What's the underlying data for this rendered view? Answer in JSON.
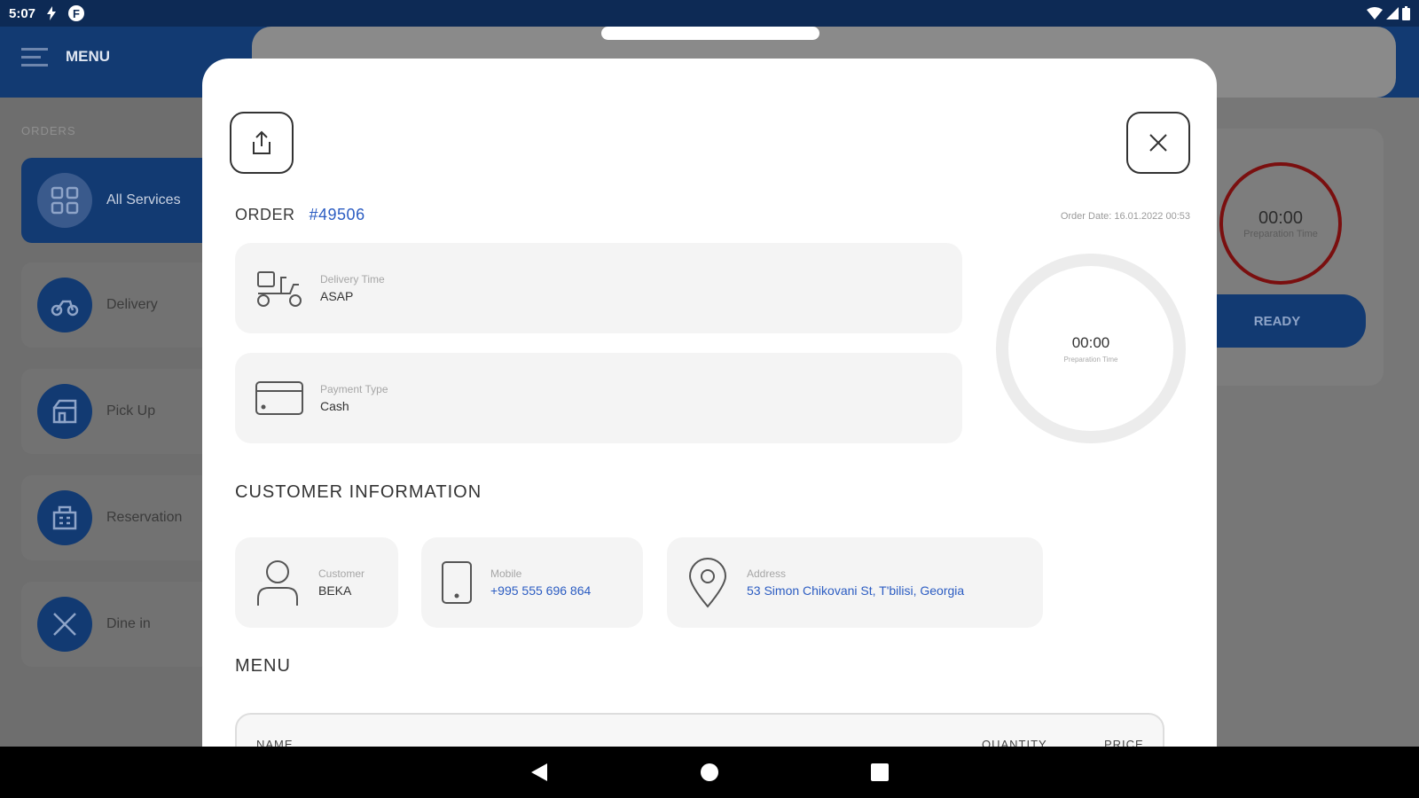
{
  "status_bar": {
    "time": "5:07"
  },
  "background": {
    "menu_label": "MENU",
    "orders_label": "ORDERS",
    "nav_items": [
      {
        "label": "All Services",
        "icon": "grid-icon"
      },
      {
        "label": "Delivery",
        "icon": "scooter-icon"
      },
      {
        "label": "Pick Up",
        "icon": "store-icon"
      },
      {
        "label": "Reservation",
        "icon": "building-icon"
      },
      {
        "label": "Dine in",
        "icon": "utensils-icon"
      }
    ],
    "card_timer": "00:00",
    "card_timer_label": "Preparation Time",
    "ready_label": "READY"
  },
  "modal": {
    "order_label": "ORDER",
    "order_number": "#49506",
    "order_date": "Order Date: 16.01.2022 00:53",
    "delivery_time_label": "Delivery Time",
    "delivery_time_value": "ASAP",
    "payment_type_label": "Payment Type",
    "payment_type_value": "Cash",
    "timer": "00:00",
    "timer_label": "Preparation Time",
    "customer_section_title": "CUSTOMER INFORMATION",
    "customer_label": "Customer",
    "customer_value": "BEKA",
    "mobile_label": "Mobile",
    "mobile_value": "+995 555 696 864",
    "address_label": "Address",
    "address_value": "53 Simon Chikovani St, T'bilisi, Georgia",
    "menu_section_title": "MENU",
    "table_headers": {
      "name": "NAME",
      "quantity": "QUANTITY",
      "price": "PRICE"
    }
  },
  "colors": {
    "primary": "#123a72",
    "link": "#2b5cc2",
    "ring_alert": "#7a0f0f"
  }
}
